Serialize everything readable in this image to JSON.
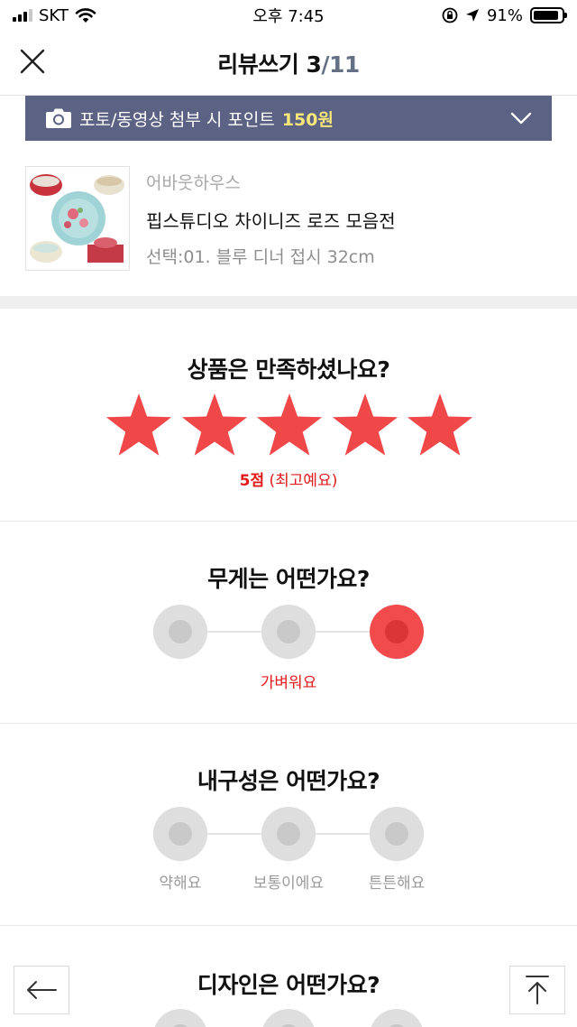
{
  "status_bar": {
    "carrier": "SKT",
    "time": "오후 7:45",
    "battery": "91%",
    "battery_level": 0.91,
    "icons": [
      "signal-icon",
      "wifi-icon",
      "orientation-lock-icon",
      "location-arrow-icon",
      "battery-icon"
    ]
  },
  "header": {
    "title": "리뷰쓰기",
    "step_current": "3",
    "step_total": "/11",
    "close_icon": "close-icon"
  },
  "banner": {
    "text": "포토/동영상 첨부 시 포인트",
    "points": "150원",
    "colors": {
      "background": "#5b6283",
      "points": "#f7e67a"
    },
    "icons": [
      "camera-icon",
      "chevron-down-icon"
    ]
  },
  "product": {
    "brand": "어바웃하우스",
    "name": "핍스튜디오 차이니즈 로즈 모음전",
    "option": "선택:01. 블루 디너 접시 32cm"
  },
  "satisfaction": {
    "question": "상품은 만족하셨나요?",
    "rating": 5,
    "max_rating": 5,
    "score_label": "5점",
    "score_desc": "(최고예요)",
    "star_color": "#f04848"
  },
  "weight": {
    "question": "무게는 어떤가요?",
    "selected_index": 2,
    "selected_label": "가벼워요"
  },
  "durability": {
    "question": "내구성은 어떤가요?",
    "options": [
      "약해요",
      "보통이에요",
      "튼튼해요"
    ]
  },
  "design": {
    "question": "디자인은 어떤가요?"
  },
  "nav": {
    "back_icon": "arrow-left-icon",
    "top_icon": "arrow-up-to-top-icon"
  },
  "colors": {
    "accent_red": "#e31b1b",
    "option_selected": "#f14b4b",
    "option_unselected": "#dedede"
  }
}
